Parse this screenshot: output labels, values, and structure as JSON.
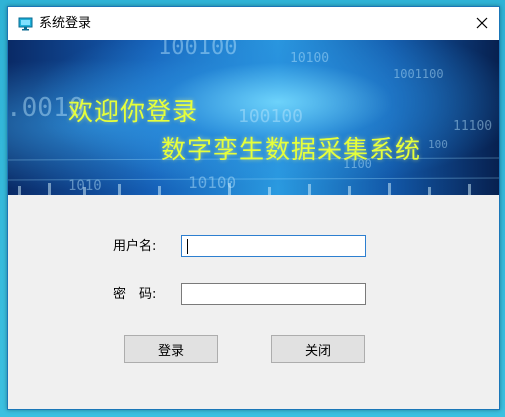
{
  "window": {
    "title": "系统登录"
  },
  "banner": {
    "welcome": "欢迎你登录",
    "system_name": "数字孪生数据采集系统",
    "binary_texts": [
      "100100",
      "10100",
      "1001100",
      ".0010",
      "100100",
      "11100",
      "100",
      "1100",
      "10100",
      "1010"
    ]
  },
  "form": {
    "username_label": "用户名:",
    "username_value": "",
    "password_label": "密　码:",
    "password_value": ""
  },
  "buttons": {
    "login": "登录",
    "close": "关闭"
  },
  "colors": {
    "banner_text": "#e6ff3a",
    "window_border": "#1a77b8",
    "input_focus_border": "#2d7fd0"
  }
}
